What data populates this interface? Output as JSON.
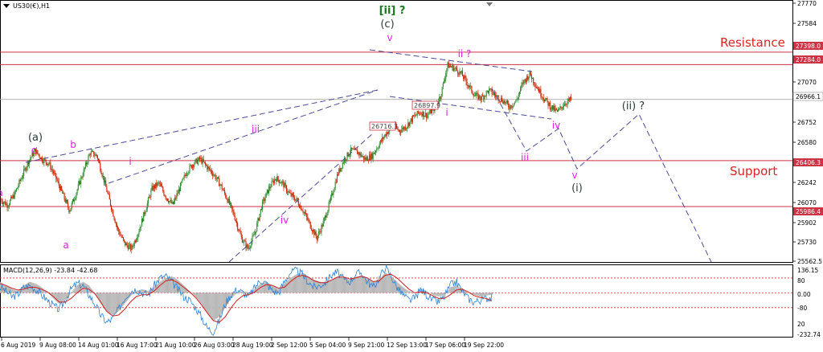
{
  "window": {
    "title": "US30(€),H1",
    "macd_label": "MACD(12,26,9) -23.84 -42.68"
  },
  "colors": {
    "bull": "#2e8b2e",
    "bear": "#cc2200",
    "level_line": "#cc3344",
    "wave_magenta": "#e020e0",
    "wave_dark": "#2e3a3a",
    "wave_green": "#1a7a1a",
    "trend_dash": "#4a4a9a",
    "text_red": "#dd2222",
    "macd_hist": "#b8b8b8",
    "macd_main": "#2a7fd0",
    "macd_signal": "#cc2222"
  },
  "price_axis": {
    "min": 25480,
    "max": 27860,
    "ticks": [
      "27770",
      "27584",
      "27398.0",
      "27284.0",
      "27070",
      "26966.1",
      "26752",
      "26580",
      "26406.3",
      "26242",
      "26070",
      "25986.4",
      "25902",
      "25730",
      "25562.5"
    ]
  },
  "levels": [
    {
      "value": 27398.0,
      "label": "27398.0"
    },
    {
      "value": 27284.0,
      "label": "27284.0"
    },
    {
      "value": 26406.3,
      "label": "26406.3"
    },
    {
      "value": 25986.4,
      "label": "25986.4"
    }
  ],
  "current_price": {
    "value": 26966.1,
    "label": "26966.1"
  },
  "price_tags": [
    {
      "value": 26716.3,
      "label": "26716.3"
    },
    {
      "value": 26897.9,
      "label": "26897.9"
    }
  ],
  "text_labels": {
    "resistance": "Resistance",
    "support": "Support"
  },
  "time_axis": [
    "6 Aug 2019",
    "9 Aug 08:00",
    "14 Aug 01:00",
    "16 Aug 17:00",
    "21 Aug 10:00",
    "26 Aug 03:00",
    "28 Aug 19:00",
    "2 Sep 12:00",
    "5 Sep 04:00",
    "9 Sep 21:00",
    "12 Sep 13:00",
    "17 Sep 06:00",
    "19 Sep 22:00"
  ],
  "macd_axis": {
    "ticks": [
      "136.15",
      "80",
      "0.00",
      "-80",
      "20",
      "-232.74"
    ]
  },
  "wave_labels": [
    {
      "text": "a",
      "color": "magenta",
      "price": 26210,
      "bar": 0
    },
    {
      "text": "(a)",
      "color": "dark",
      "price": 26580,
      "bar": 38
    },
    {
      "text": "c",
      "color": "magenta",
      "price": 26510,
      "bar": 38
    },
    {
      "text": "b",
      "color": "magenta",
      "price": 26540,
      "bar": 82
    },
    {
      "text": "a",
      "color": "magenta",
      "price": 25670,
      "bar": 75
    },
    {
      "text": "i",
      "color": "magenta",
      "price": 26420,
      "bar": 156
    },
    {
      "text": "iii",
      "color": "magenta",
      "price": 26710,
      "bar": 312
    },
    {
      "text": "iv",
      "color": "magenta",
      "price": 25910,
      "bar": 348
    },
    {
      "text": "[ii] ?",
      "color": "green",
      "price": 27740,
      "bar": 479
    },
    {
      "text": "(c)",
      "color": "dark",
      "price": 27600,
      "bar": 479
    },
    {
      "text": "v",
      "color": "magenta",
      "price": 27450,
      "bar": 479
    },
    {
      "text": "ii ?",
      "color": "magenta",
      "price": 27300,
      "bar": 570
    },
    {
      "text": "i",
      "color": "magenta",
      "price": 26870,
      "bar": 553
    },
    {
      "text": "iv",
      "color": "magenta",
      "price": 26740,
      "bar": 686
    },
    {
      "text": "iii",
      "color": "magenta",
      "price": 26410,
      "bar": 647
    },
    {
      "text": "v",
      "color": "magenta",
      "price": 26300,
      "bar": 712
    },
    {
      "text": "(i)",
      "color": "dark",
      "price": 26180,
      "bar": 712
    },
    {
      "text": "(ii) ?",
      "color": "dark",
      "price": 26930,
      "bar": 785
    }
  ],
  "chart_data": {
    "type": "candlestick",
    "title": "US30(€),H1",
    "ylim": [
      25480,
      27860
    ],
    "closes": [
      26050,
      26000,
      26100,
      26250,
      26400,
      26500,
      26420,
      26380,
      26250,
      26100,
      25950,
      26120,
      26300,
      26480,
      26450,
      26230,
      26000,
      25780,
      25650,
      25600,
      25750,
      25950,
      26150,
      26200,
      26080,
      26000,
      26150,
      26300,
      26380,
      26420,
      26350,
      26280,
      26180,
      26050,
      25900,
      25700,
      25600,
      25750,
      26000,
      26150,
      26250,
      26200,
      26100,
      26050,
      25950,
      25820,
      25700,
      25850,
      26050,
      26280,
      26420,
      26500,
      26480,
      26420,
      26450,
      26550,
      26650,
      26720,
      26680,
      26720,
      26800,
      26850,
      26820,
      26880,
      27000,
      27280,
      27250,
      27200,
      27100,
      27000,
      26980,
      27050,
      27000,
      26960,
      26900,
      26950,
      27120,
      27200,
      27080,
      26980,
      26900,
      26850,
      26930,
      26966
    ]
  },
  "macd": {
    "hist": [
      60,
      40,
      20,
      10,
      40,
      60,
      50,
      30,
      5,
      -30,
      -60,
      -40,
      0,
      40,
      60,
      40,
      0,
      -60,
      -100,
      -120,
      -100,
      -60,
      -20,
      10,
      20,
      10,
      30,
      60,
      80,
      90,
      70,
      40,
      10,
      -20,
      -60,
      -110,
      -150,
      -130,
      -80,
      -30,
      0,
      10,
      0,
      20,
      50,
      60,
      40,
      20,
      50,
      80,
      100,
      110,
      90,
      70,
      60,
      55,
      70,
      90,
      80,
      70,
      85,
      95,
      80,
      60,
      70,
      110,
      90,
      60,
      30,
      10,
      0,
      20,
      10,
      -10,
      -20,
      -10,
      30,
      40,
      20,
      0,
      -10,
      -20,
      -15,
      -10
    ],
    "main": [
      30,
      10,
      -20,
      -10,
      30,
      40,
      20,
      -10,
      -40,
      -70,
      -90,
      -40,
      20,
      50,
      40,
      -10,
      -60,
      -120,
      -160,
      -140,
      -90,
      -30,
      10,
      20,
      0,
      -10,
      40,
      80,
      90,
      60,
      20,
      -20,
      -40,
      -80,
      -130,
      -190,
      -210,
      -150,
      -60,
      -10,
      20,
      0,
      -20,
      30,
      70,
      50,
      10,
      0,
      60,
      110,
      120,
      100,
      60,
      30,
      40,
      60,
      100,
      110,
      70,
      60,
      100,
      110,
      60,
      30,
      80,
      140,
      90,
      30,
      -10,
      -40,
      -30,
      20,
      -10,
      -40,
      -50,
      -20,
      40,
      60,
      10,
      -30,
      -50,
      -40,
      -30,
      -24
    ],
    "signal": [
      50,
      40,
      25,
      15,
      20,
      30,
      30,
      20,
      5,
      -20,
      -50,
      -50,
      -30,
      0,
      25,
      20,
      -5,
      -50,
      -100,
      -125,
      -120,
      -90,
      -50,
      -20,
      -10,
      -10,
      10,
      40,
      65,
      70,
      55,
      30,
      5,
      -25,
      -65,
      -110,
      -150,
      -160,
      -130,
      -80,
      -40,
      -15,
      -10,
      5,
      30,
      45,
      40,
      25,
      30,
      60,
      85,
      95,
      85,
      65,
      55,
      55,
      70,
      85,
      85,
      75,
      80,
      90,
      80,
      60,
      65,
      95,
      100,
      80,
      50,
      20,
      0,
      5,
      0,
      -15,
      -30,
      -30,
      -10,
      15,
      20,
      5,
      -15,
      -25,
      -30,
      -43
    ]
  }
}
